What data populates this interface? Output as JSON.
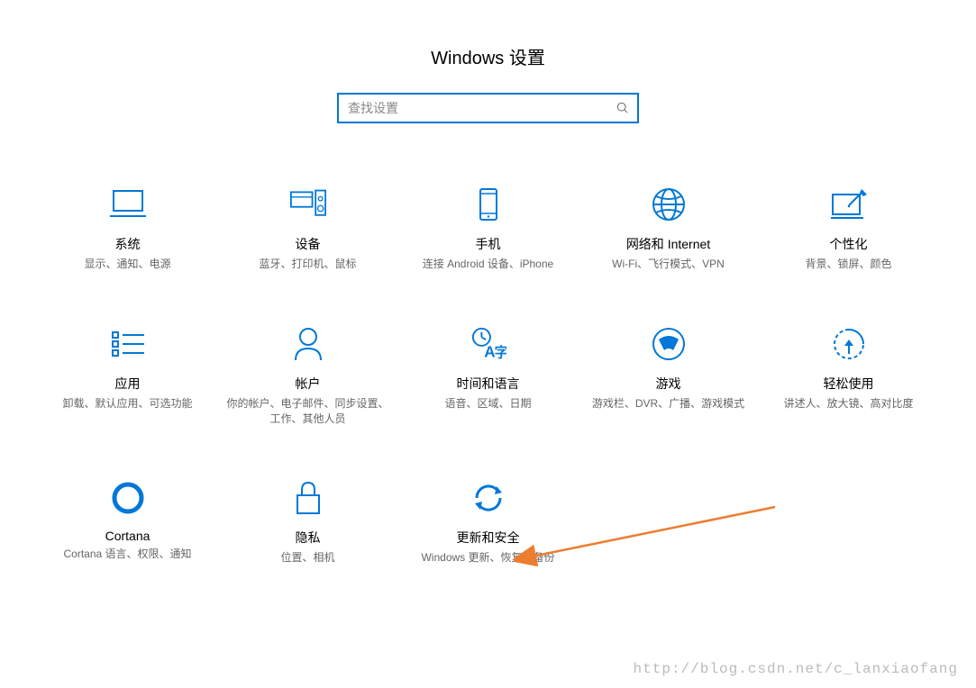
{
  "header": {
    "title": "Windows 设置"
  },
  "search": {
    "placeholder": "查找设置"
  },
  "tiles": [
    {
      "title": "系统",
      "desc": "显示、通知、电源"
    },
    {
      "title": "设备",
      "desc": "蓝牙、打印机、鼠标"
    },
    {
      "title": "手机",
      "desc": "连接 Android 设备、iPhone"
    },
    {
      "title": "网络和 Internet",
      "desc": "Wi-Fi、飞行模式、VPN"
    },
    {
      "title": "个性化",
      "desc": "背景、锁屏、颜色"
    },
    {
      "title": "应用",
      "desc": "卸载、默认应用、可选功能"
    },
    {
      "title": "帐户",
      "desc": "你的帐户、电子邮件、同步设置、工作、其他人员"
    },
    {
      "title": "时间和语言",
      "desc": "语音、区域、日期"
    },
    {
      "title": "游戏",
      "desc": "游戏栏、DVR、广播、游戏模式"
    },
    {
      "title": "轻松使用",
      "desc": "讲述人、放大镜、高对比度"
    },
    {
      "title": "Cortana",
      "desc": "Cortana 语言、权限、通知"
    },
    {
      "title": "隐私",
      "desc": "位置、相机"
    },
    {
      "title": "更新和安全",
      "desc": "Windows 更新、恢复、备份"
    }
  ],
  "watermark": "http://blog.csdn.net/c_lanxiaofang",
  "colors": {
    "accent": "#0078d7",
    "arrow": "#ed7d31"
  }
}
